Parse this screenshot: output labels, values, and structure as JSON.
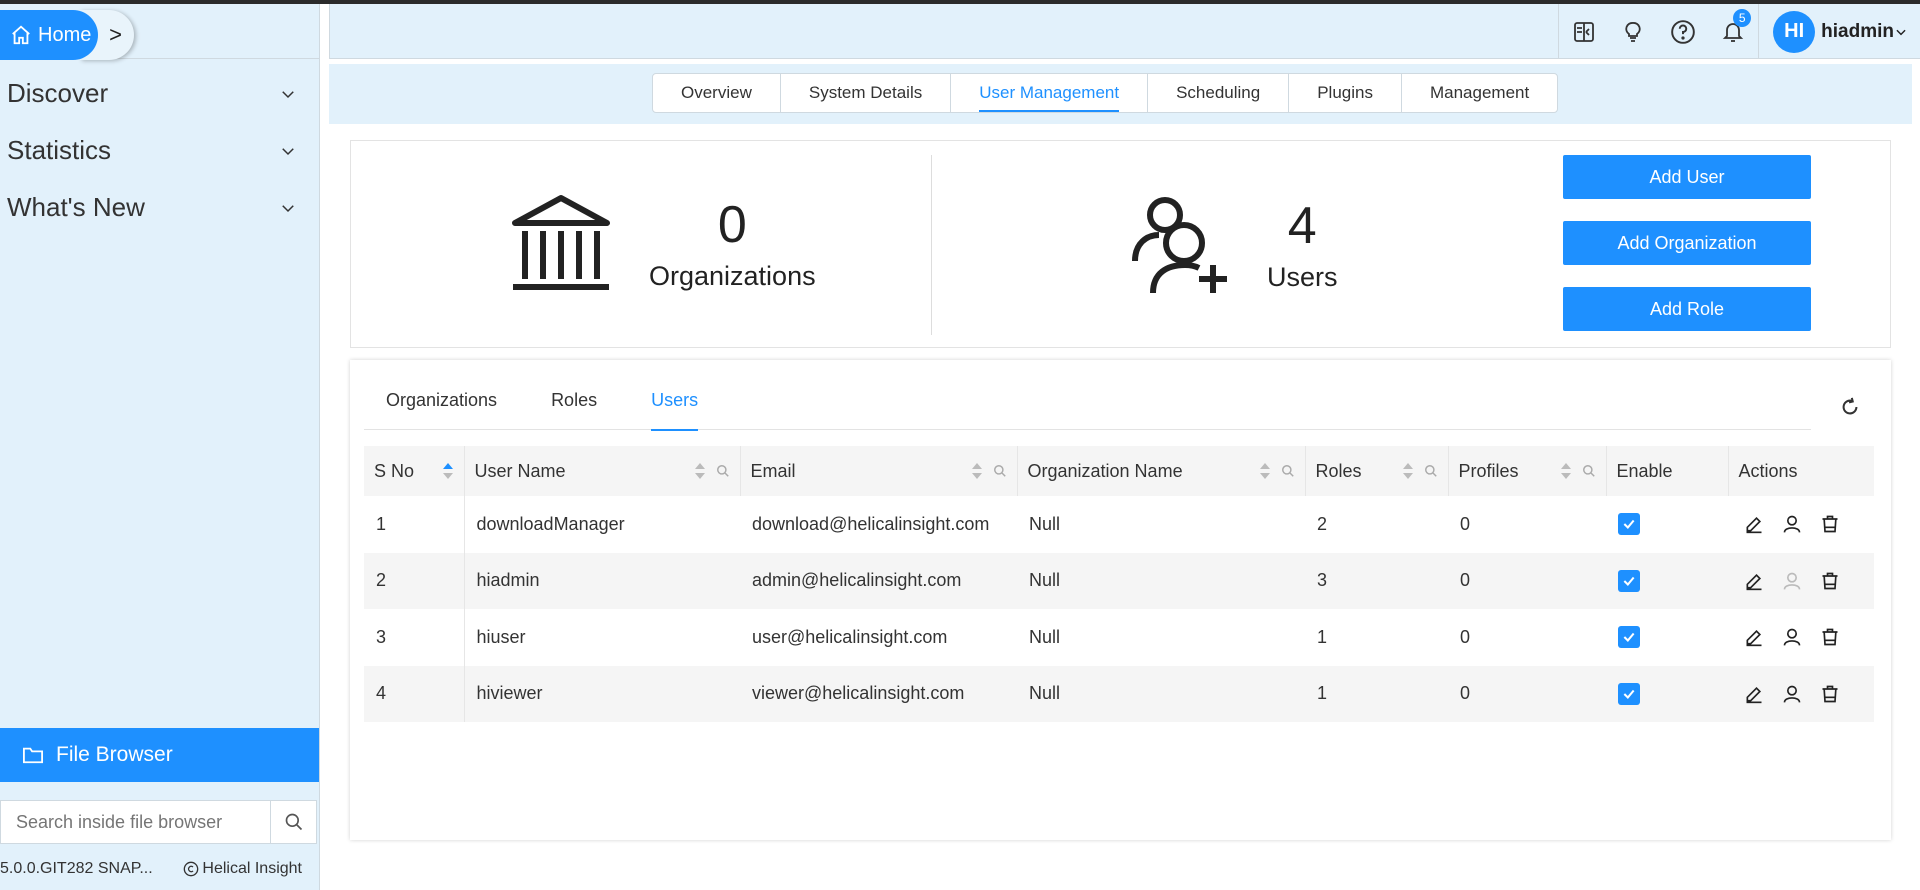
{
  "sidebar": {
    "home_label": "Home",
    "crumb_arrow": ">",
    "items": [
      {
        "label": "Discover"
      },
      {
        "label": "Statistics"
      },
      {
        "label": "What's New"
      }
    ],
    "file_browser_label": "File Browser",
    "search_placeholder": "Search inside file browser",
    "version": "5.0.0.GIT282 SNAP...",
    "brand": "Helical Insight"
  },
  "header": {
    "notification_count": "5",
    "avatar_initials": "HI",
    "username": "hiadmin"
  },
  "tabs": [
    {
      "label": "Overview"
    },
    {
      "label": "System Details"
    },
    {
      "label": "User Management",
      "active": true
    },
    {
      "label": "Scheduling"
    },
    {
      "label": "Plugins"
    },
    {
      "label": "Management"
    }
  ],
  "summary": {
    "organizations": {
      "count": "0",
      "label": "Organizations"
    },
    "users": {
      "count": "4",
      "label": "Users"
    },
    "buttons": {
      "add_user": "Add User",
      "add_organization": "Add Organization",
      "add_role": "Add Role"
    }
  },
  "subtabs": [
    {
      "label": "Organizations"
    },
    {
      "label": "Roles"
    },
    {
      "label": "Users",
      "active": true
    }
  ],
  "table": {
    "headers": {
      "sno": "S No",
      "username": "User Name",
      "email": "Email",
      "org": "Organization Name",
      "roles": "Roles",
      "profiles": "Profiles",
      "enable": "Enable",
      "actions": "Actions"
    },
    "rows": [
      {
        "sno": "1",
        "username": "downloadManager",
        "email": "download@helicalinsight.com",
        "org": "Null",
        "roles": "2",
        "profiles": "0",
        "enabled": true
      },
      {
        "sno": "2",
        "username": "hiadmin",
        "email": "admin@helicalinsight.com",
        "org": "Null",
        "roles": "3",
        "profiles": "0",
        "enabled": true
      },
      {
        "sno": "3",
        "username": "hiuser",
        "email": "user@helicalinsight.com",
        "org": "Null",
        "roles": "1",
        "profiles": "0",
        "enabled": true
      },
      {
        "sno": "4",
        "username": "hiviewer",
        "email": "viewer@helicalinsight.com",
        "org": "Null",
        "roles": "1",
        "profiles": "0",
        "enabled": true
      }
    ]
  },
  "colors": {
    "accent": "#1e90ff",
    "sidebar_bg": "#e2f1fb"
  }
}
